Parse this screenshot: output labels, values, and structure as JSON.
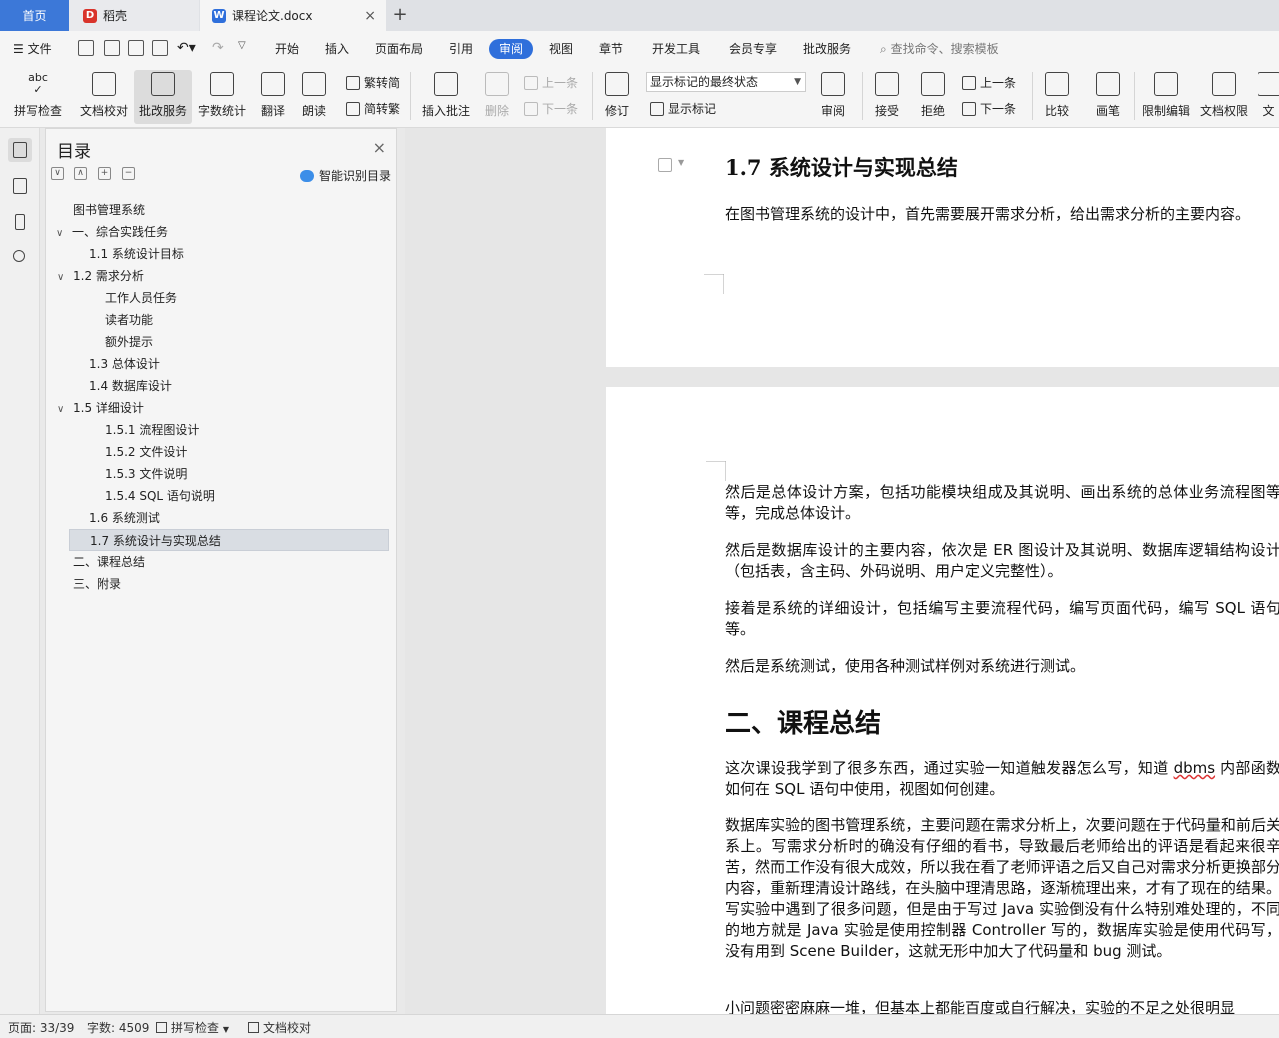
{
  "tabs": {
    "home": "首页",
    "daoke": "稻壳",
    "doc": "课程论文.docx",
    "add": "+",
    "close": "×"
  },
  "menu": {
    "file": "文件",
    "items": [
      "开始",
      "插入",
      "页面布局",
      "引用",
      "审阅",
      "视图",
      "章节",
      "开发工具",
      "会员专享",
      "批改服务"
    ],
    "active": "审阅",
    "search": "查找命令、搜索模板"
  },
  "toolbar": {
    "spellcheck": "拼写检查",
    "proofread": "文档校对",
    "correction_service": "批改服务",
    "word_count": "字数统计",
    "translate": "翻译",
    "read_aloud": "朗读",
    "to_traditional": "繁转简",
    "to_simplified": "简转繁",
    "insert_comment": "插入批注",
    "delete": "删除",
    "prev_comment": "上一条",
    "next_comment": "下一条",
    "track_changes": "修订",
    "markup_state": "显示标记的最终状态",
    "show_markup": "显示标记",
    "review_pane": "审阅",
    "accept": "接受",
    "reject": "拒绝",
    "prev_change": "上一条",
    "next_change": "下一条",
    "compare": "比较",
    "pen": "画笔",
    "restrict_edit": "限制编辑",
    "doc_permission": "文档权限",
    "doc_more": "文"
  },
  "toc": {
    "title": "目录",
    "close": "×",
    "smart": "智能识别目录",
    "items": [
      {
        "label": "图书管理系统",
        "level": 0,
        "expander": ""
      },
      {
        "label": "一、综合实践任务",
        "level": 0,
        "expander": "∨"
      },
      {
        "label": "1.1  系统设计目标",
        "level": 1,
        "expander": ""
      },
      {
        "label": "1.2  需求分析",
        "level": 1,
        "expander": "∨"
      },
      {
        "label": "工作人员任务",
        "level": 2,
        "expander": ""
      },
      {
        "label": "读者功能",
        "level": 2,
        "expander": ""
      },
      {
        "label": "额外提示",
        "level": 2,
        "expander": ""
      },
      {
        "label": "1.3  总体设计",
        "level": 1,
        "expander": ""
      },
      {
        "label": "1.4  数据库设计",
        "level": 1,
        "expander": ""
      },
      {
        "label": "1.5  详细设计",
        "level": 1,
        "expander": "∨"
      },
      {
        "label": "1.5.1  流程图设计",
        "level": 2,
        "expander": ""
      },
      {
        "label": "1.5.2  文件设计",
        "level": 2,
        "expander": ""
      },
      {
        "label": "1.5.3  文件说明",
        "level": 2,
        "expander": ""
      },
      {
        "label": "1.5.4 SQL  语句说明",
        "level": 2,
        "expander": ""
      },
      {
        "label": "1.6  系统测试",
        "level": 1,
        "expander": ""
      },
      {
        "label": "1.7  系统设计与实现总结",
        "level": 1,
        "expander": "",
        "selected": true
      },
      {
        "label": "二、课程总结",
        "level": 0,
        "expander": ""
      },
      {
        "label": "三、附录",
        "level": 0,
        "expander": ""
      }
    ]
  },
  "document": {
    "heading_17": "1.7  系统设计与实现总结",
    "p1": "在图书管理系统的设计中，首先需要展开需求分析，给出需求分析的主要内容。",
    "p2": "然后是总体设计方案，包括功能模块组成及其说明、画出系统的总体业务流程图等等，完成总体设计。",
    "p3": "然后是数据库设计的主要内容，依次是 ER 图设计及其说明、数据库逻辑结构设计（包括表，含主码、外码说明、用户定义完整性）。",
    "p4": "接着是系统的详细设计，包括编写主要流程代码，编写页面代码，编写 SQL 语句等。",
    "p5": "然后是系统测试，使用各种测试样例对系统进行测试。",
    "heading_course": "二、课程总结",
    "p6_a": "这次课设我学到了很多东西，通过实验一知道触发器怎么写，知道 ",
    "p6_dbms": "dbms",
    "p6_b": " 内部函数如何在 SQL 语句中使用，视图如何创建。",
    "p7": "数据库实验的图书管理系统，主要问题在需求分析上，次要问题在于代码量和前后关系上。写需求分析时的确没有仔细的看书，导致最后老师给出的评语是看起来很辛苦，然而工作没有很大成效，所以我在看了老师评语之后又自己对需求分析更换部分内容，重新理清设计路线，在头脑中理清思路，逐渐梳理出来，才有了现在的结果。写实验中遇到了很多问题，但是由于写过 Java 实验倒没有什么特别难处理的，不同的地方就是 Java 实验是使用控制器 Controller 写的，数据库实验是使用代码写，没有用到 Scene Builder，这就无形中加大了代码量和 bug 测试。",
    "p8": "小问题密密麻麻一堆，但基本上都能百度或自行解决，实验的不足之处很明显"
  },
  "status": {
    "page": "页面: 33/39",
    "words": "字数: 4509",
    "spellcheck": "拼写检查",
    "proofread": "文档校对"
  },
  "colors": {
    "accent": "#2f6fdb",
    "home_tab": "#3c78d8"
  }
}
